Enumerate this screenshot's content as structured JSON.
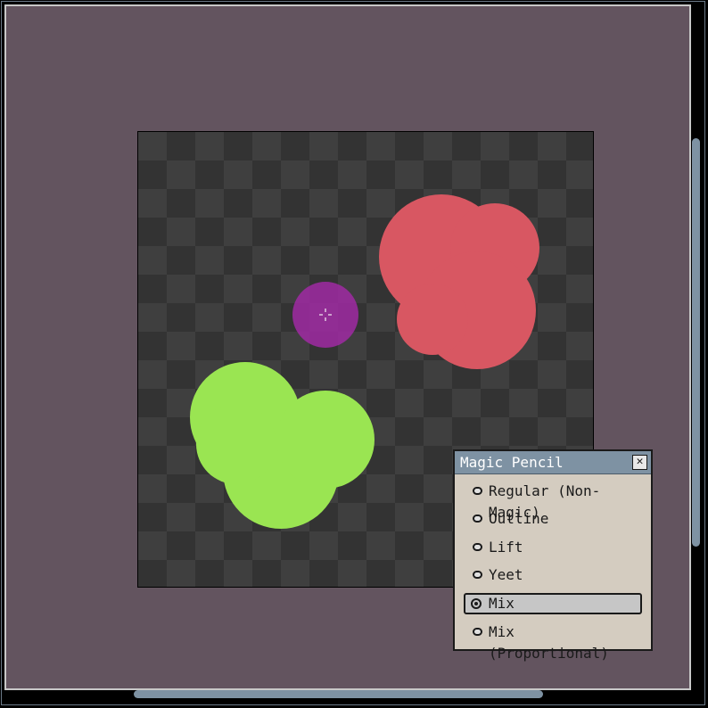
{
  "panel": {
    "title": "Magic Pencil",
    "close_icon": "close-x-icon",
    "options": [
      {
        "label": "Regular (Non-Magic)",
        "selected": false
      },
      {
        "label": "Outline",
        "selected": false
      },
      {
        "label": "Lift",
        "selected": false
      },
      {
        "label": "Yeet",
        "selected": false
      },
      {
        "label": "Mix",
        "selected": true
      },
      {
        "label": "Mix (Proportional)",
        "selected": false
      }
    ]
  },
  "canvas": {
    "blobs": [
      {
        "name": "red-blob",
        "color": "#d85762"
      },
      {
        "name": "green-blob",
        "color": "#9ae552"
      }
    ],
    "brush_cursor_color": "#a02aa3",
    "crosshair_icon": "crosshair-icon"
  },
  "colors": {
    "workspace": "#63545f",
    "scrollbar": "#7e92a3",
    "panel_bg": "#d4ccc0",
    "panel_title": "#7e92a3"
  }
}
